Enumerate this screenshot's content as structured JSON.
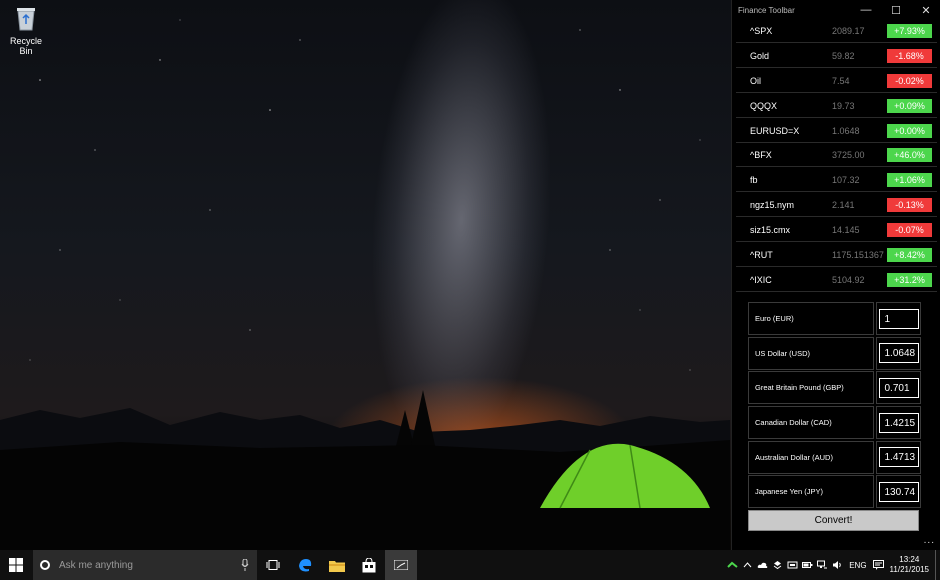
{
  "desktop": {
    "recycle_bin_label": "Recycle Bin"
  },
  "window": {
    "title": "Finance Toolbar",
    "minimize_glyph": "—",
    "maximize_glyph": "☐",
    "close_glyph": "✕"
  },
  "tickers": [
    {
      "symbol": "^SPX",
      "price": "2089.17",
      "change": "+7.93%",
      "direction": "up"
    },
    {
      "symbol": "Gold",
      "price": "59.82",
      "change": "-1.68%",
      "direction": "down"
    },
    {
      "symbol": "Oil",
      "price": "7.54",
      "change": "-0.02%",
      "direction": "down"
    },
    {
      "symbol": "QQQX",
      "price": "19.73",
      "change": "+0.09%",
      "direction": "up"
    },
    {
      "symbol": "EURUSD=X",
      "price": "1.0648",
      "change": "+0.00%",
      "direction": "up"
    },
    {
      "symbol": "^BFX",
      "price": "3725.00",
      "change": "+46.0%",
      "direction": "up"
    },
    {
      "symbol": "fb",
      "price": "107.32",
      "change": "+1.06%",
      "direction": "up"
    },
    {
      "symbol": "ngz15.nym",
      "price": "2.141",
      "change": "-0.13%",
      "direction": "down"
    },
    {
      "symbol": "siz15.cmx",
      "price": "14.145",
      "change": "-0.07%",
      "direction": "down"
    },
    {
      "symbol": "^RUT",
      "price": "1175.151367",
      "change": "+8.42%",
      "direction": "up"
    },
    {
      "symbol": "^IXIC",
      "price": "5104.92",
      "change": "+31.2%",
      "direction": "up"
    }
  ],
  "converter": {
    "rows": [
      {
        "currency": "Euro (EUR)",
        "value": "1"
      },
      {
        "currency": "US Dollar (USD)",
        "value": "1.0648"
      },
      {
        "currency": "Great Britain Pound (GBP)",
        "value": "0.701"
      },
      {
        "currency": "Canadian Dollar (CAD)",
        "value": "1.4215"
      },
      {
        "currency": "Australian Dollar (AUD)",
        "value": "1.4713"
      },
      {
        "currency": "Japanese Yen (JPY)",
        "value": "130.74"
      }
    ],
    "convert_label": "Convert!",
    "more_glyph": "..."
  },
  "taskbar": {
    "search_placeholder": "Ask me anything",
    "language": "ENG",
    "time": "13:24",
    "date": "11/21/2015"
  },
  "colors": {
    "up": "#4cd64c",
    "down": "#f03a3a",
    "accent": "#1e90ff"
  }
}
